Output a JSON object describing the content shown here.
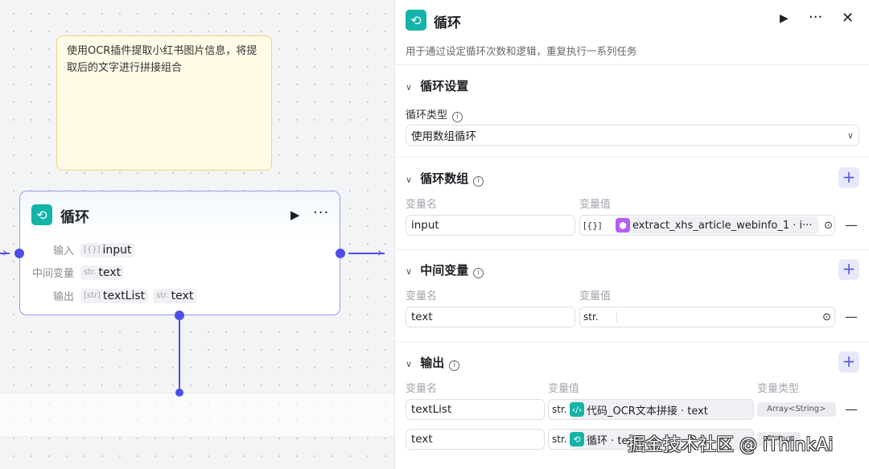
{
  "note": {
    "text": "使用OCR插件提取小红书图片信息，将提取后的文字进行拼接组合"
  },
  "node": {
    "title": "循环",
    "rows": [
      {
        "label": "输入",
        "tags": [
          {
            "type": "[{}]",
            "name": "input"
          }
        ]
      },
      {
        "label": "中间变量",
        "tags": [
          {
            "type": "str.",
            "name": "text"
          }
        ]
      },
      {
        "label": "输出",
        "tags": [
          {
            "type": "[str]",
            "name": "textList"
          },
          {
            "type": "str.",
            "name": "text"
          }
        ]
      }
    ]
  },
  "panel": {
    "title": "循环",
    "description": "用于通过设定循环次数和逻辑，重复执行一系列任务",
    "settings": {
      "title": "循环设置",
      "type_label": "循环类型",
      "type_value": "使用数组循环"
    },
    "loop_array": {
      "title": "循环数组",
      "name_label": "变量名",
      "value_label": "变量值",
      "name": "input",
      "type": "[{}]",
      "ref": "extract_xhs_article_webinfo_1 · i···"
    },
    "intermediate": {
      "title": "中间变量",
      "name_label": "变量名",
      "value_label": "变量值",
      "name": "text",
      "type": "str."
    },
    "output": {
      "title": "输出",
      "name_label": "变量名",
      "value_label": "变量值",
      "type_label": "变量类型",
      "rows": [
        {
          "name": "textList",
          "type": "str.",
          "ref": "代码_OCR文本拼接 · text",
          "var_type": "Array<String>"
        },
        {
          "name": "text",
          "type": "str.",
          "ref": "循环 · text",
          "var_type": "String"
        }
      ]
    }
  },
  "watermark": "掘金技术社区 @ iThinkAi",
  "colors": {
    "accent": "#4e4ee6",
    "loop_icon": "#13b3a7",
    "plugin_icon": "#b65cf0"
  }
}
